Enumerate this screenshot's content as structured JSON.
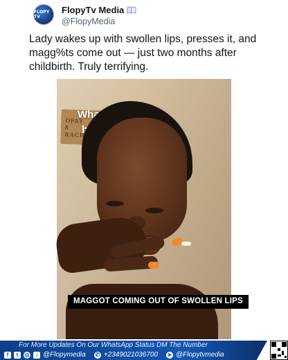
{
  "account": {
    "avatar_text": "FLOPY TV",
    "display_name": "FlopyTv Media",
    "handle": "@FlopyMedia",
    "badge_icon": "open-book-icon"
  },
  "tweet": {
    "text": "Lady wakes up with swollen lips, presses it, and magg%ts come out — just two months after childbirth. Truly terrifying."
  },
  "video": {
    "overlay_line1": "What do you think",
    "overlay_line2": "happened",
    "overlay_emojis": [
      "crying-face-emoji",
      "crying-face-emoji"
    ],
    "overlay_suffix": "?",
    "sign_text": [
      "OPAY",
      "8",
      "RACHEAL OKPE"
    ],
    "caption": "MAGGOT COMING OUT OF SWOLLEN LIPS"
  },
  "banner": {
    "line1": "For More Updates On Our WhatsApp Status DM The Number",
    "social_handle": "@Flopymedia",
    "phone": "+2349021036700",
    "telegram_handle": "@Flopytvmedia",
    "colors": {
      "stripe": "#1456b3",
      "text": "#ffffff"
    }
  }
}
